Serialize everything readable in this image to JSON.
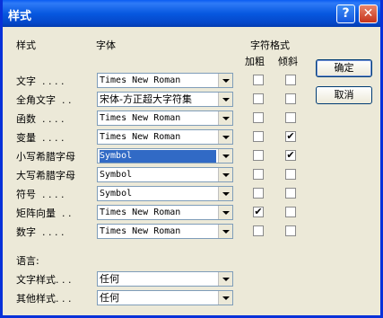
{
  "window": {
    "title": "样式"
  },
  "titlebar": {
    "help_icon_glyph": "?",
    "close_icon_glyph": "✕"
  },
  "headers": {
    "style": "样式",
    "font": "字体",
    "char_format": "字符格式",
    "bold": "加粗",
    "italic": "倾斜"
  },
  "rows": [
    {
      "label": "文字  . . . .",
      "font": "Times New Roman",
      "bold": false,
      "italic": false
    },
    {
      "label": "全角文字  . .",
      "font": "宋体-方正超大字符集",
      "bold": false,
      "italic": false
    },
    {
      "label": "函数  . . . .",
      "font": "Times New Roman",
      "bold": false,
      "italic": false
    },
    {
      "label": "变量  . . . .",
      "font": "Times New Roman",
      "bold": false,
      "italic": true
    },
    {
      "label": "小写希腊字母",
      "font": "Symbol",
      "bold": false,
      "italic": true,
      "selected": true
    },
    {
      "label": "大写希腊字母",
      "font": "Symbol",
      "bold": false,
      "italic": false
    },
    {
      "label": "符号  . . . .",
      "font": "Symbol",
      "bold": false,
      "italic": false
    },
    {
      "label": "矩阵向量  . .",
      "font": "Times New Roman",
      "bold": true,
      "italic": false
    },
    {
      "label": "数字  . . . .",
      "font": "Times New Roman",
      "bold": false,
      "italic": false
    }
  ],
  "language": {
    "heading": "语言:",
    "text_style_label": "文字样式. . .",
    "text_style_value": "任何",
    "other_style_label": "其他样式. . .",
    "other_style_value": "任何"
  },
  "buttons": {
    "ok": "确定",
    "cancel": "取消"
  },
  "check_glyph": "✔",
  "colors": {
    "titlebar": "#0758e0",
    "selection": "#316ac5",
    "dialog_bg": "#ece9d8"
  }
}
